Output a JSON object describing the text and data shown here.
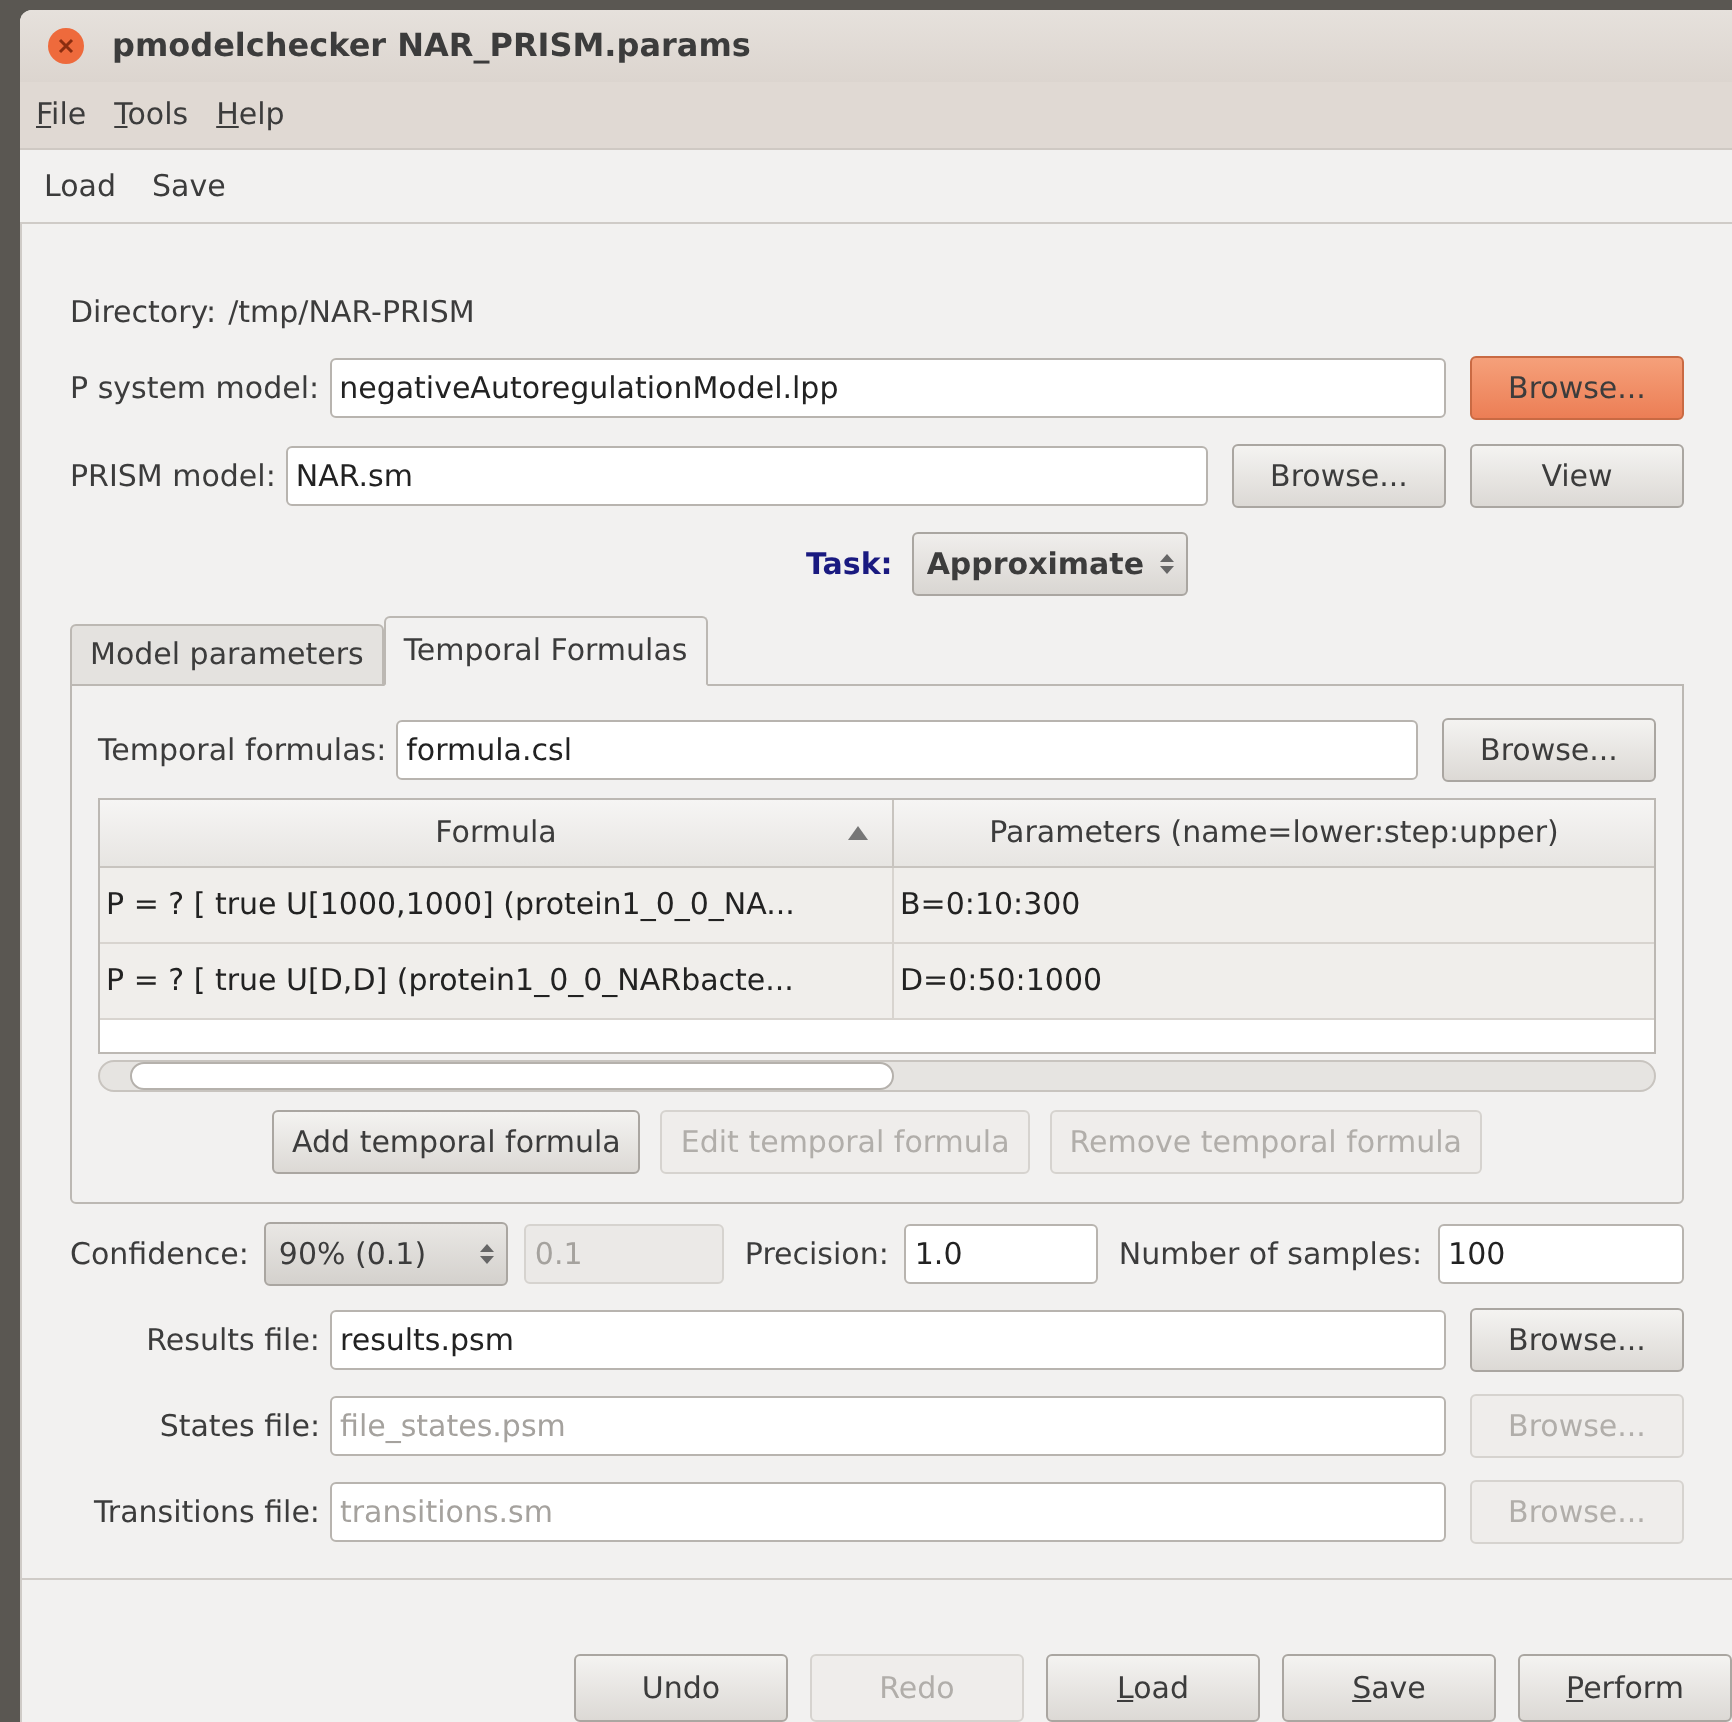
{
  "window": {
    "title": "pmodelchecker NAR_PRISM.params"
  },
  "menu": [
    {
      "label": "File",
      "mnemonic": true
    },
    {
      "label": "Tools",
      "mnemonic": true
    },
    {
      "label": "Help",
      "mnemonic": true
    }
  ],
  "toolbar": [
    {
      "label": "Load"
    },
    {
      "label": "Save"
    }
  ],
  "directory": {
    "label": "Directory:",
    "value": "/tmp/NAR-PRISM"
  },
  "p_system_model": {
    "label": "P system model:",
    "value": "negativeAutoregulationModel.lpp",
    "buttons": [
      {
        "label": "Browse...",
        "highlighted": true
      }
    ]
  },
  "prism_model": {
    "label": "PRISM model:",
    "value": "NAR.sm",
    "buttons": [
      {
        "label": "Browse...",
        "highlighted": false
      },
      {
        "label": "View",
        "highlighted": false
      }
    ]
  },
  "task": {
    "label": "Task:",
    "value": "Approximate"
  },
  "tabs": [
    {
      "label": "Model parameters",
      "selected": false
    },
    {
      "label": "Temporal Formulas",
      "selected": true
    }
  ],
  "temporal_formulas": {
    "label": "Temporal formulas:",
    "value": "formula.csl",
    "button": "Browse..."
  },
  "table": {
    "columns": [
      {
        "label": "Formula",
        "sorted": true
      },
      {
        "label": "Parameters (name=lower:step:upper)",
        "sorted": false
      }
    ],
    "rows": [
      [
        "P = ? [ true U[1000,1000] (protein1_0_0_NA...",
        "B=0:10:300"
      ],
      [
        "P = ? [ true U[D,D] (protein1_0_0_NARbacte...",
        "D=0:50:1000"
      ]
    ]
  },
  "formula_buttons": [
    {
      "label": "Add temporal formula",
      "disabled": false
    },
    {
      "label": "Edit temporal formula",
      "disabled": true
    },
    {
      "label": "Remove temporal formula",
      "disabled": true
    }
  ],
  "confidence": {
    "label": "Confidence:",
    "value": "90% (0.1)",
    "error": "0.1"
  },
  "precision": {
    "label": "Precision:",
    "value": "1.0"
  },
  "samples": {
    "label": "Number of samples:",
    "value": "100"
  },
  "files": [
    {
      "label": "Results file:",
      "value": "results.psm",
      "disabled": false,
      "button": "Browse..."
    },
    {
      "label": "States file:",
      "value": "file_states.psm",
      "disabled": true,
      "button": "Browse..."
    },
    {
      "label": "Transitions file:",
      "value": "transitions.sm",
      "disabled": true,
      "button": "Browse..."
    }
  ],
  "dialog_buttons": [
    {
      "label": "Undo",
      "disabled": false,
      "mnemonic": false
    },
    {
      "label": "Redo",
      "disabled": true,
      "mnemonic": false
    },
    {
      "label": "Load",
      "disabled": false,
      "mnemonic": true
    },
    {
      "label": "Save",
      "disabled": false,
      "mnemonic": true
    },
    {
      "label": "Perform",
      "disabled": false,
      "mnemonic": true
    }
  ]
}
